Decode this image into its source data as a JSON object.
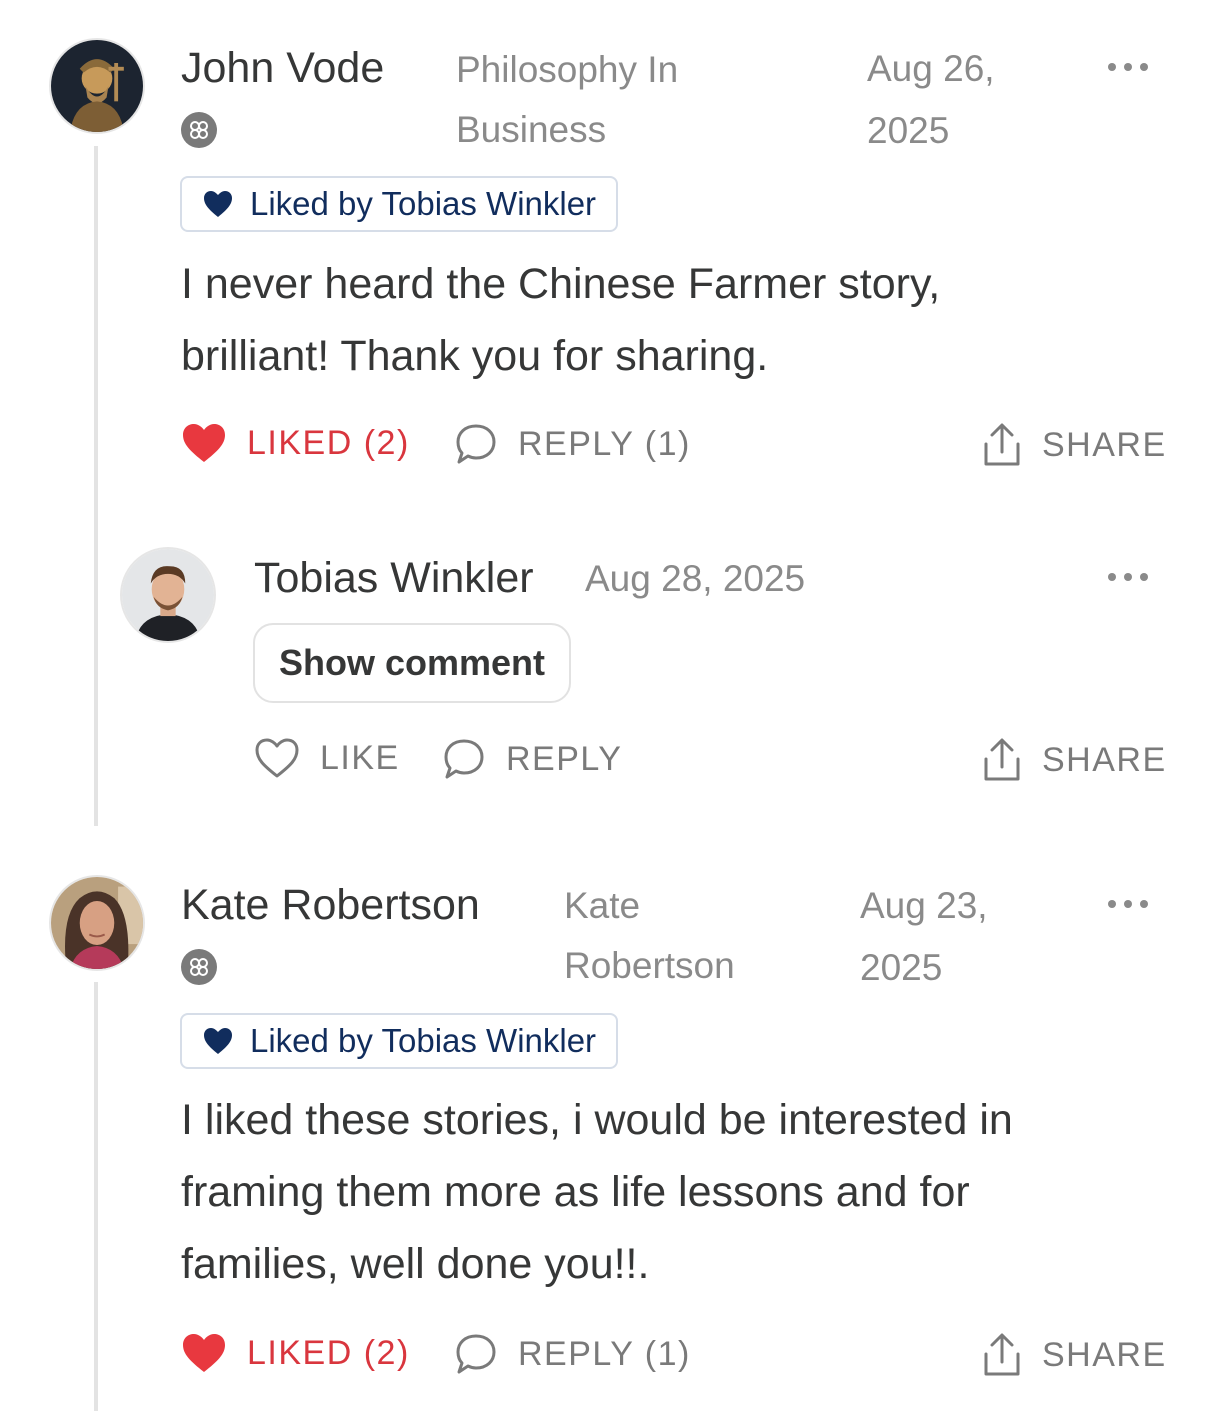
{
  "comments": [
    {
      "author": "John Vode",
      "publication_line1": "Philosophy In",
      "publication_line2": "Business",
      "date_line1": "Aug 26,",
      "date_line2": "2025",
      "liked_by": "Liked by Tobias Winkler",
      "body_line1": "I never heard the Chinese Farmer story,",
      "body_line2": "brilliant! Thank you for sharing.",
      "like_label": "LIKED (2)",
      "reply_label": "REPLY (1)",
      "share_label": "SHARE",
      "replies": [
        {
          "author": "Tobias Winkler",
          "date": "Aug 28, 2025",
          "show_comment_label": "Show comment",
          "like_label": "LIKE",
          "reply_label": "REPLY",
          "share_label": "SHARE"
        }
      ]
    },
    {
      "author": "Kate Robertson",
      "publication_line1": "Kate",
      "publication_line2": "Robertson",
      "date_line1": "Aug 23,",
      "date_line2": "2025",
      "liked_by": "Liked by Tobias Winkler",
      "body_line1": "I liked these stories, i would be interested in",
      "body_line2": "framing them more as life lessons and for",
      "body_line3": "families, well done you!!.",
      "like_label": "LIKED (2)",
      "reply_label": "REPLY (1)",
      "share_label": "SHARE"
    }
  ],
  "colors": {
    "liked_red": "#d9363e",
    "pill_navy": "#112d5d",
    "muted_gray": "#8a8a8a"
  },
  "icons": [
    "heart-filled-icon",
    "heart-outline-icon",
    "comment-bubble-icon",
    "share-upload-icon",
    "more-dots-icon",
    "subscriber-badge-icon",
    "navy-heart-icon"
  ]
}
